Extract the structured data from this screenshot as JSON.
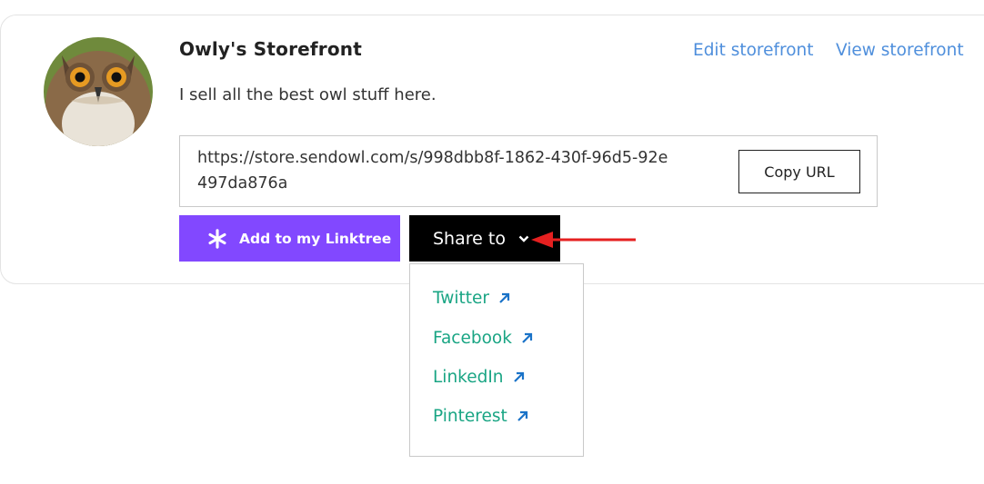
{
  "store": {
    "title": "Owly's Storefront",
    "description": "I sell all the best owl stuff here.",
    "avatar_icon": "owl-avatar"
  },
  "links": {
    "edit": "Edit storefront",
    "view": "View storefront"
  },
  "url_box": {
    "url": "https://store.sendowl.com/s/998dbb8f-1862-430f-96d5-92e497da876a",
    "copy_label": "Copy URL"
  },
  "buttons": {
    "linktree_label": "Add to my Linktree",
    "linktree_icon": "linktree-asterisk-icon",
    "share_label": "Share to",
    "share_icon": "chevron-down-icon"
  },
  "share_menu": {
    "items": [
      {
        "label": "Twitter",
        "icon": "external-arrow-icon"
      },
      {
        "label": "Facebook",
        "icon": "external-arrow-icon"
      },
      {
        "label": "LinkedIn",
        "icon": "external-arrow-icon"
      },
      {
        "label": "Pinterest",
        "icon": "external-arrow-icon"
      }
    ]
  },
  "colors": {
    "link": "#4f8fdc",
    "linktree": "#8248ff",
    "share_bg": "#000000",
    "menu_text": "#1aa584",
    "menu_icon": "#1a73c8",
    "annotation_arrow": "#e52020"
  }
}
